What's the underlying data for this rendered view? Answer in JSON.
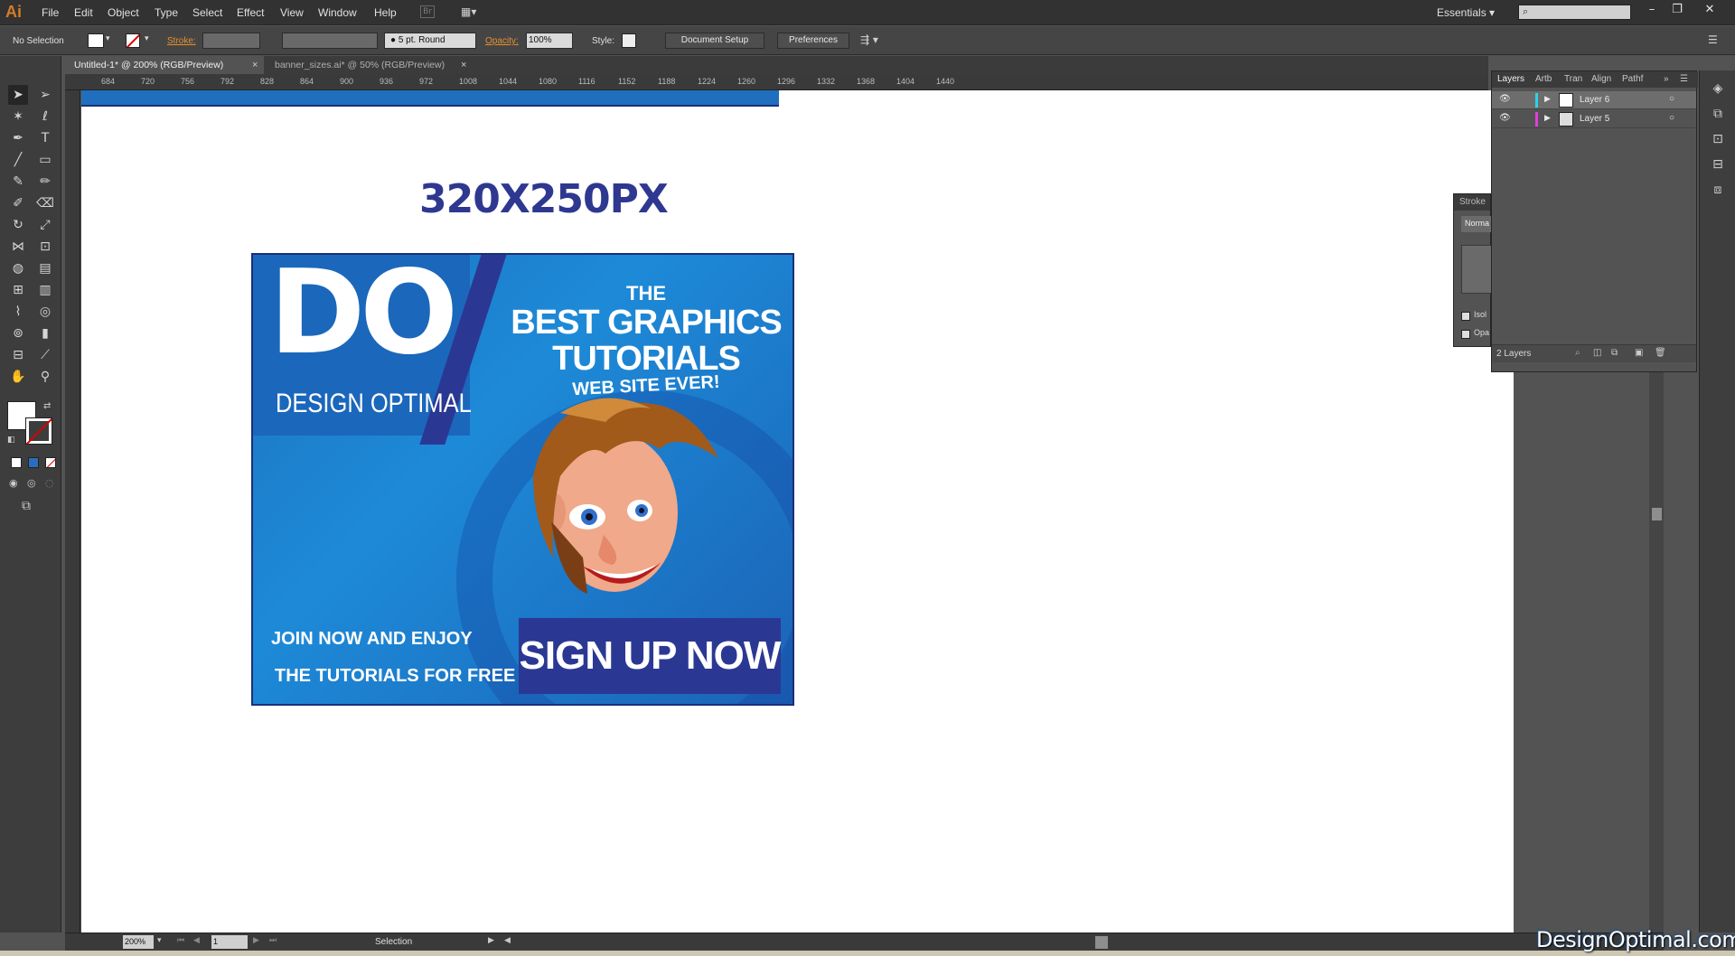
{
  "app": {
    "logo": "Ai"
  },
  "menu": [
    "File",
    "Edit",
    "Object",
    "Type",
    "Select",
    "Effect",
    "View",
    "Window",
    "Help"
  ],
  "workspace": "Essentials",
  "control_bar": {
    "selection_label": "No Selection",
    "stroke_label": "Stroke:",
    "brush_label": "5 pt. Round",
    "opacity_label": "Opacity:",
    "opacity_value": "100%",
    "style_label": "Style:",
    "document_setup": "Document Setup",
    "preferences": "Preferences"
  },
  "tabs": [
    {
      "label": "Untitled-1* @ 200% (RGB/Preview)",
      "close": "×"
    },
    {
      "label": "banner_sizes.ai* @ 50% (RGB/Preview)",
      "close": "×"
    }
  ],
  "ruler_top": [
    "684",
    "720",
    "756",
    "792",
    "828",
    "864",
    "900",
    "936",
    "972",
    "1008",
    "1044",
    "1080",
    "1116",
    "1152",
    "1188",
    "1224",
    "1260",
    "1296",
    "1332",
    "1368",
    "1404",
    "1440"
  ],
  "canvas": {
    "size_title": "320X250PX"
  },
  "banner": {
    "logo_big": "DO",
    "logo_sub": "DESIGN OPTIMAL",
    "headline_1": "THE",
    "headline_2": "BEST GRAPHICS",
    "headline_3": "TUTORIALS",
    "headline_4": "WEB SITE EVER!",
    "join": "JOIN NOW AND ENJOY",
    "free": "THE TUTORIALS FOR FREE",
    "cta": "SIGN UP NOW"
  },
  "layers_panel": {
    "tabs": [
      "Layers",
      "Artb",
      "Tran",
      "Align",
      "Pathf"
    ],
    "layers": [
      "Layer 6",
      "Layer 5"
    ],
    "count": "2 Layers"
  },
  "stroke_panel": {
    "title": "Stroke",
    "mode": "Norma",
    "isolate": "Isol",
    "opacity": "Opa"
  },
  "status_bar": {
    "zoom": "200%",
    "page": "1",
    "tool": "Selection"
  },
  "watermark": "DesignOptimal.com"
}
